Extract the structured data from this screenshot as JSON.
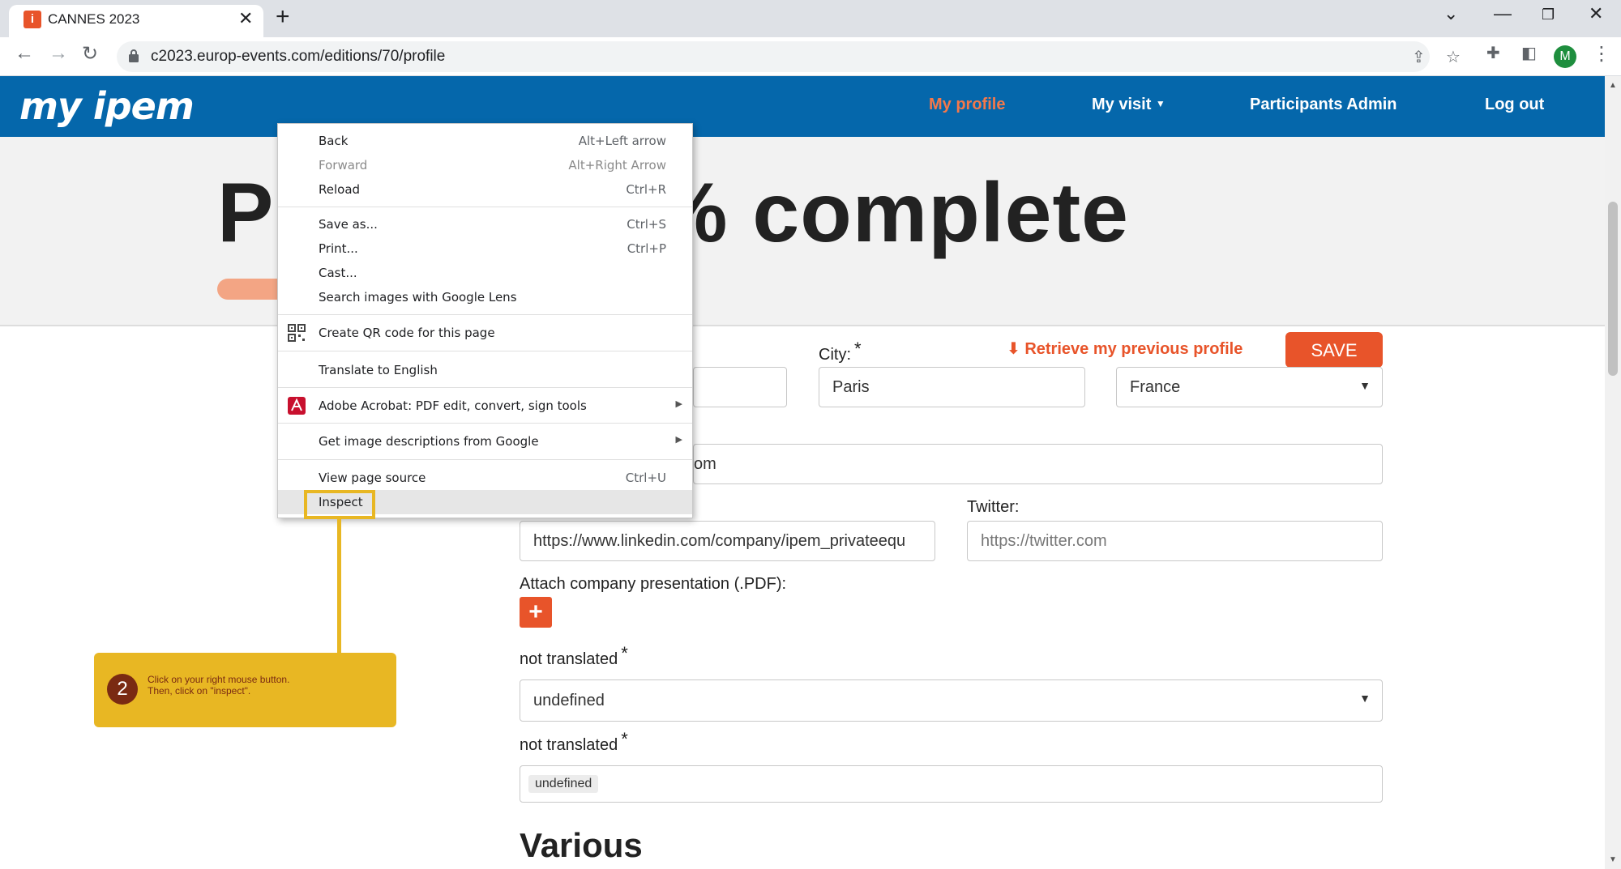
{
  "browser": {
    "tab_title": "CANNES 2023",
    "favicon_glyph": "i",
    "url": "c2023.europ-events.com/editions/70/profile",
    "avatar_letter": "M"
  },
  "site": {
    "logo": "my ipem",
    "nav": {
      "my_profile": "My profile",
      "my_visit": "My visit",
      "participants_admin": "Participants Admin",
      "log_out": "Log out"
    }
  },
  "hero": {
    "title": "Profile 100% complete",
    "progress_percent": 100
  },
  "form": {
    "retrieve_label": "Retrieve my previous profile",
    "save_label": "SAVE",
    "city_label": "City:",
    "city_value": "Paris",
    "country_value": "France",
    "website_value_fragment": "om",
    "twitter_label": "Twitter:",
    "linkedin_value": "https://www.linkedin.com/company/ipem_privateequ",
    "twitter_placeholder": "https://twitter.com",
    "attach_label": "Attach company presentation (.PDF):",
    "field1_label": "not translated",
    "field1_value": "undefined",
    "field2_label": "not translated",
    "field2_tag": "undefined",
    "required_mark": "*",
    "section_various": "Various"
  },
  "context_menu": {
    "items": [
      {
        "label": "Back",
        "shortcut": "Alt+Left arrow"
      },
      {
        "label": "Forward",
        "shortcut": "Alt+Right Arrow"
      },
      {
        "label": "Reload",
        "shortcut": "Ctrl+R"
      },
      {
        "label": "Save as...",
        "shortcut": "Ctrl+S"
      },
      {
        "label": "Print...",
        "shortcut": "Ctrl+P"
      },
      {
        "label": "Cast...",
        "shortcut": ""
      },
      {
        "label": "Search images with Google Lens",
        "shortcut": ""
      },
      {
        "label": "Create QR code for this page",
        "shortcut": ""
      },
      {
        "label": "Translate to English",
        "shortcut": ""
      },
      {
        "label": "Adobe Acrobat: PDF edit, convert, sign tools",
        "shortcut": ""
      },
      {
        "label": "Get image descriptions from Google",
        "shortcut": ""
      },
      {
        "label": "View page source",
        "shortcut": "Ctrl+U"
      },
      {
        "label": "Inspect",
        "shortcut": ""
      }
    ]
  },
  "annotation": {
    "step_number": "2",
    "text_line1": "Click on your right mouse button.",
    "text_line2": "Then, click on \"inspect\"."
  },
  "colors": {
    "header_blue": "#0567ab",
    "accent_orange": "#e8542a",
    "callout_yellow": "#e8b723"
  }
}
